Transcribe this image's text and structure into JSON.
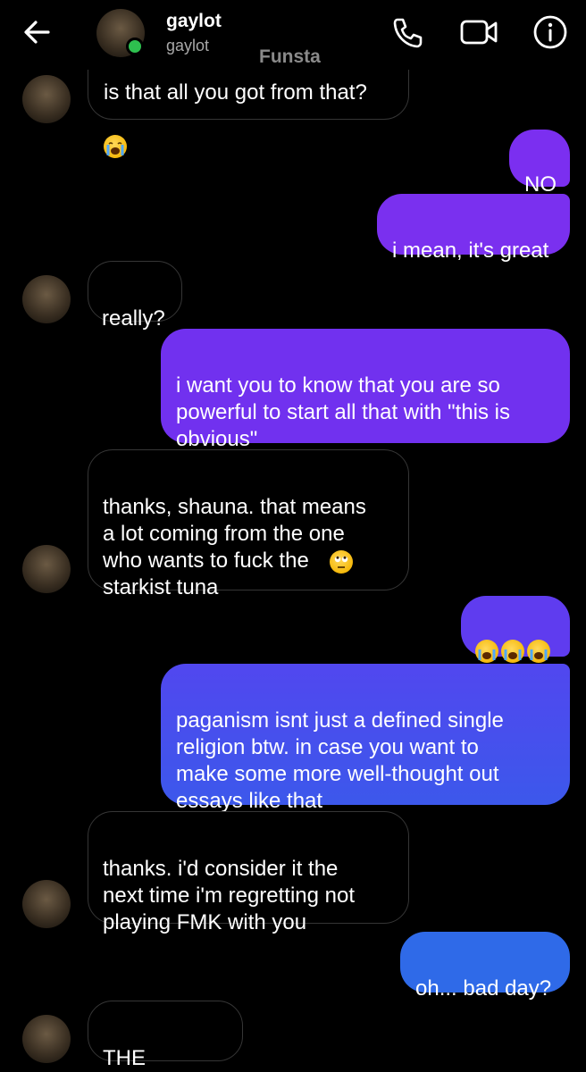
{
  "header": {
    "title": "gaylot",
    "subtitle": "gaylot",
    "watermark": "Funsta",
    "icons": [
      "back-arrow-icon",
      "phone-icon",
      "video-icon",
      "info-icon"
    ]
  },
  "colors": {
    "background": "#000000",
    "incoming_border": "#363636",
    "outgoing_purple": "#7b2ff0",
    "outgoing_indigo": "#5545ef",
    "outgoing_blue": "#2f6ae8",
    "online": "#2ec04f"
  },
  "messages": [
    {
      "from": "them",
      "text": "is that all you got from that?",
      "emoji": "loudly-crying-face"
    },
    {
      "from": "me",
      "text": "NO"
    },
    {
      "from": "me",
      "text": "i mean, it's great"
    },
    {
      "from": "them",
      "text": "really?"
    },
    {
      "from": "me",
      "text": "i want you to know that you are so\npowerful to start all that with \"this is\nobvious\""
    },
    {
      "from": "them",
      "text": "thanks, shauna. that means\na lot coming from the one\nwho wants to fuck the\nstarkist  tuna",
      "emoji": "face-with-rolling-eyes"
    },
    {
      "from": "me",
      "text": "",
      "emoji": "loudly-crying-face x3"
    },
    {
      "from": "me",
      "text": "paganism isnt just a defined single\nreligion btw. in case you want to\nmake some more well-thought out\nessays like that"
    },
    {
      "from": "them",
      "text": "thanks. i'd consider it the\nnext time i'm regretting not\nplaying FMK with you"
    },
    {
      "from": "me",
      "text": "oh... bad day?"
    },
    {
      "from": "them",
      "text": "THE WORST"
    }
  ]
}
